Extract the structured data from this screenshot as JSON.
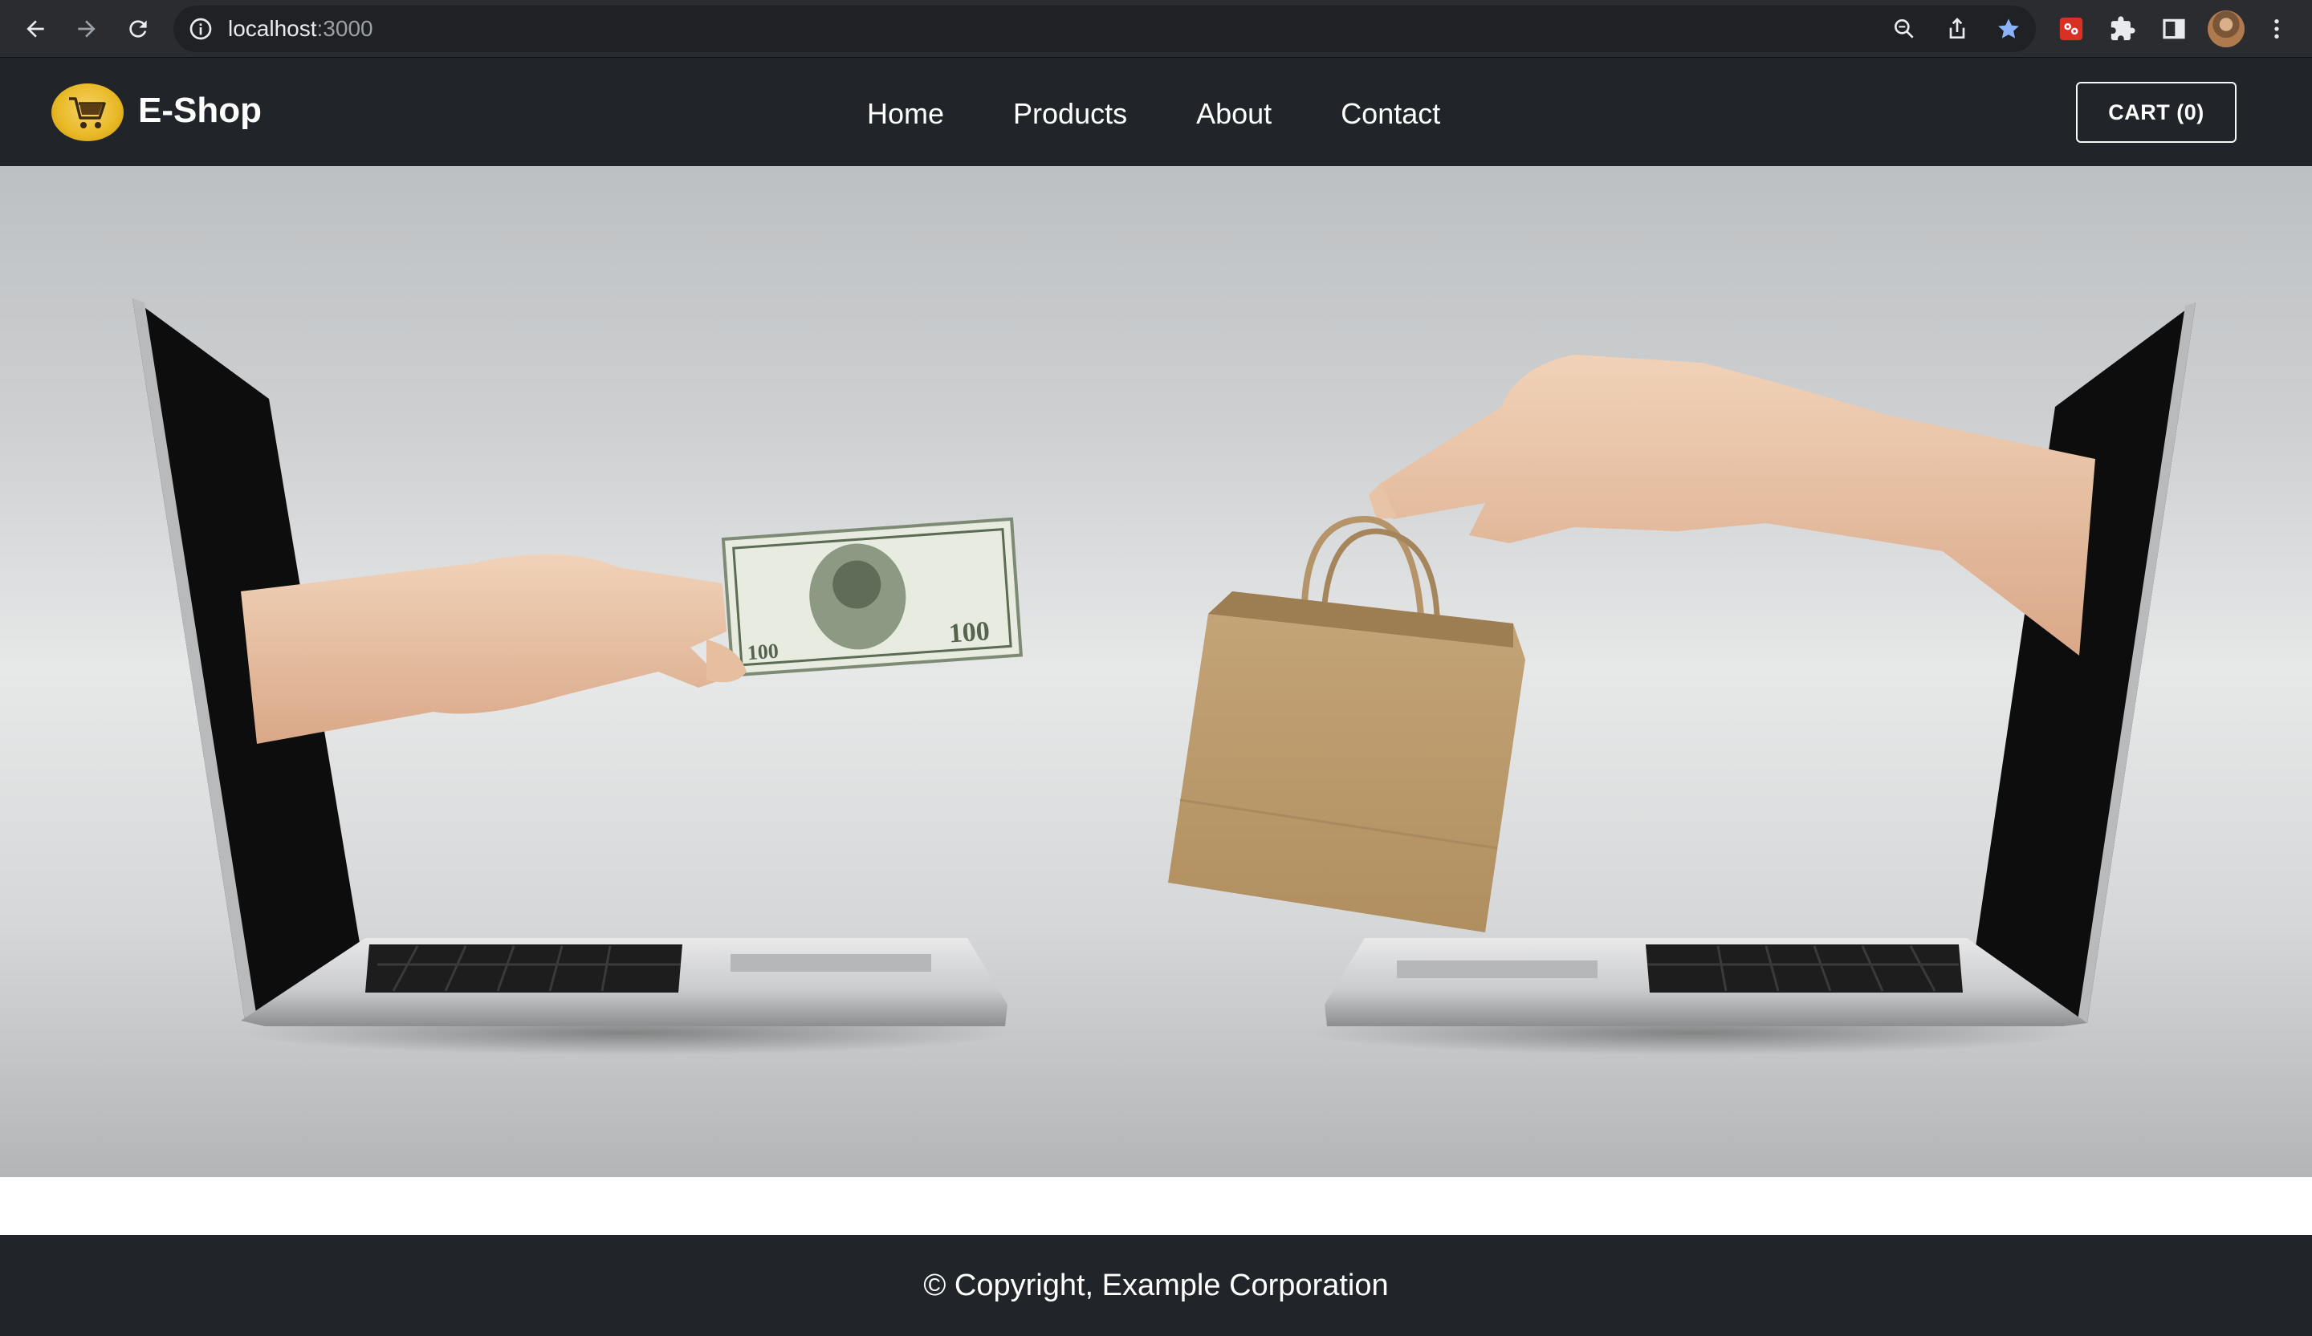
{
  "browser": {
    "url_host": "localhost",
    "url_port": ":3000"
  },
  "navbar": {
    "brand": "E-Shop",
    "links": [
      "Home",
      "Products",
      "About",
      "Contact"
    ],
    "cart_label": "CART (0)"
  },
  "footer": {
    "copyright": "© Copyright, Example Corporation"
  },
  "colors": {
    "navbar_bg": "#212529",
    "footer_bg": "#212529",
    "brand_logo": "#e8b824",
    "bookmark_star": "#8ab4f8"
  }
}
